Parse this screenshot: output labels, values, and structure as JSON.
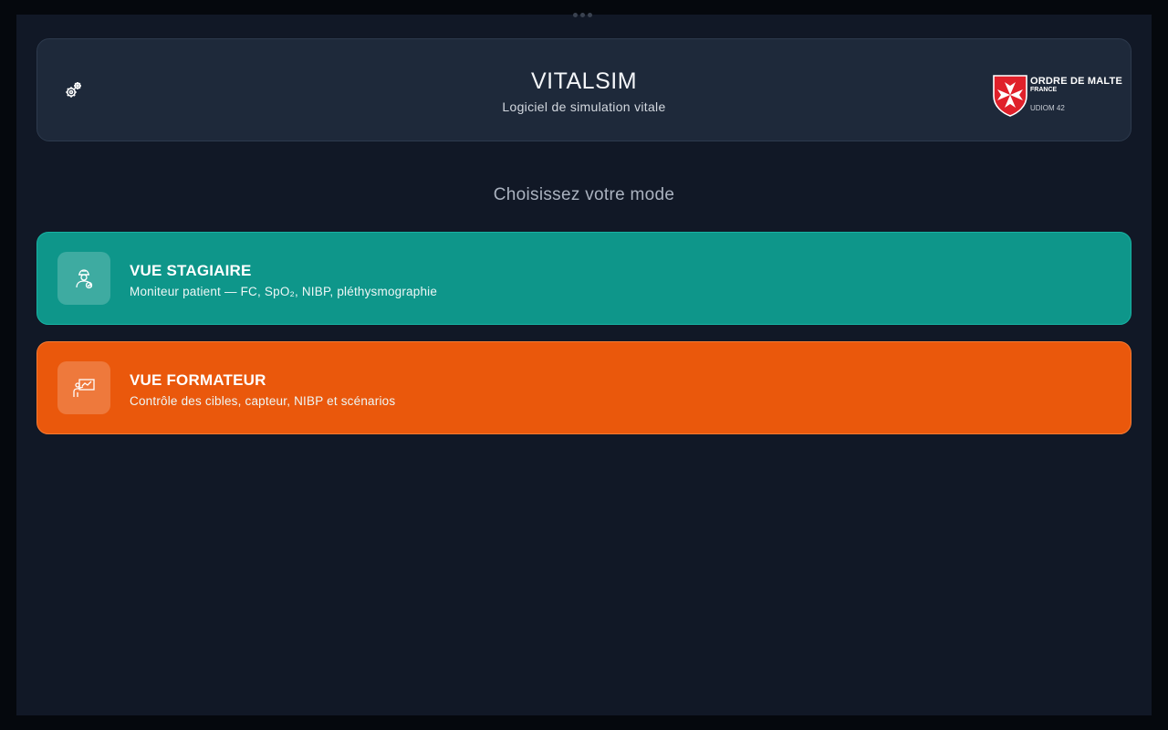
{
  "header": {
    "title": "VITALSIM",
    "subtitle": "Logiciel de simulation vitale",
    "settings_icon": "gears-icon",
    "logo": {
      "org": "ORDRE DE MALTE",
      "country": "FRANCE",
      "unit": "UDIOM 42"
    }
  },
  "main": {
    "prompt": "Choisissez votre mode",
    "modes": [
      {
        "title": "VUE STAGIAIRE",
        "description": "Moniteur patient — FC, SpO₂, NIBP, pléthysmographie",
        "icon": "trainee-icon",
        "color": "#0e968a"
      },
      {
        "title": "VUE FORMATEUR",
        "description": "Contrôle des cibles, capteur, NIBP et scénarios",
        "icon": "instructor-board-icon",
        "color": "#ea580c"
      }
    ]
  }
}
